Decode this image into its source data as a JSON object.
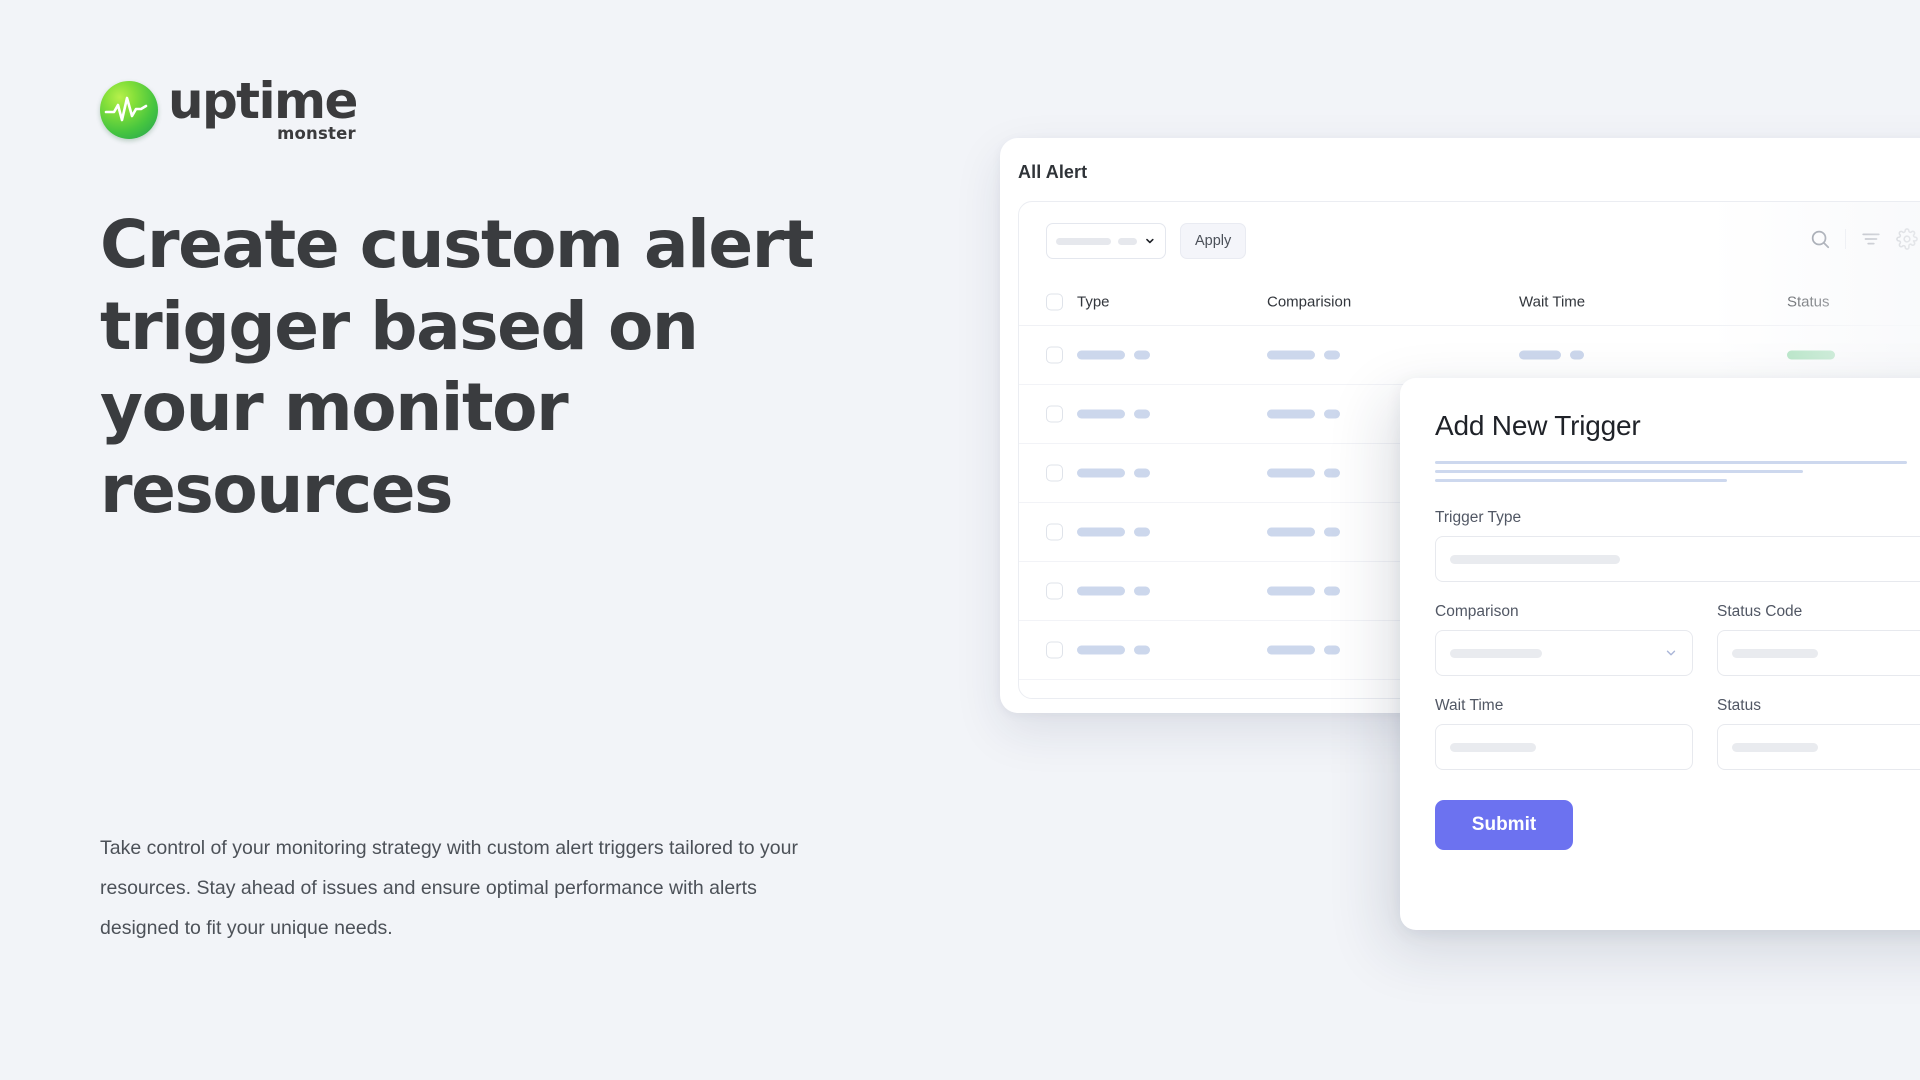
{
  "brand": {
    "name_primary": "uptime",
    "name_secondary": "monster",
    "logo_icon": "pulse-circle-icon",
    "accent_green_start": "#b7f04b",
    "accent_green_end": "#1f9e54"
  },
  "hero": {
    "headline": "Create custom alert trigger based on your monitor resources",
    "paragraph": "Take control of your monitoring strategy with custom alert triggers tailored to your resources. Stay ahead of issues and ensure optimal performance with alerts designed to fit your unique needs."
  },
  "alert_card": {
    "title": "All Alert",
    "toolbar": {
      "filter_select_value": "",
      "apply_label": "Apply",
      "search_icon": "search-icon",
      "filter_icon": "filter-icon",
      "settings_icon": "gear-icon",
      "add_label": "+",
      "add_accent": "#6c72f0"
    },
    "table": {
      "columns": [
        "Type",
        "Comparision",
        "Wait Time",
        "Status"
      ],
      "add_column_label": "+",
      "row_count": 6,
      "status_pill_color": "#9fdfb4",
      "skeleton_color": "#ccd7ec",
      "row_menu_icon": "more-horizontal-icon"
    }
  },
  "modal": {
    "title": "Add New Trigger",
    "description_lines": [
      100,
      78,
      62
    ],
    "fields": {
      "trigger_type": {
        "label": "Trigger Type",
        "type": "select",
        "value": "",
        "skeleton_width": 170
      },
      "comparison": {
        "label": "Comparison",
        "type": "select",
        "value": "",
        "skeleton_width": 92
      },
      "status_code": {
        "label": "Status Code",
        "type": "text",
        "value": "",
        "skeleton_width": 86
      },
      "wait_time": {
        "label": "Wait Time",
        "type": "text",
        "value": "",
        "skeleton_width": 86
      },
      "status": {
        "label": "Status",
        "type": "select",
        "value": "",
        "skeleton_width": 86
      }
    },
    "submit_label": "Submit",
    "submit_color": "#6c72f0"
  }
}
